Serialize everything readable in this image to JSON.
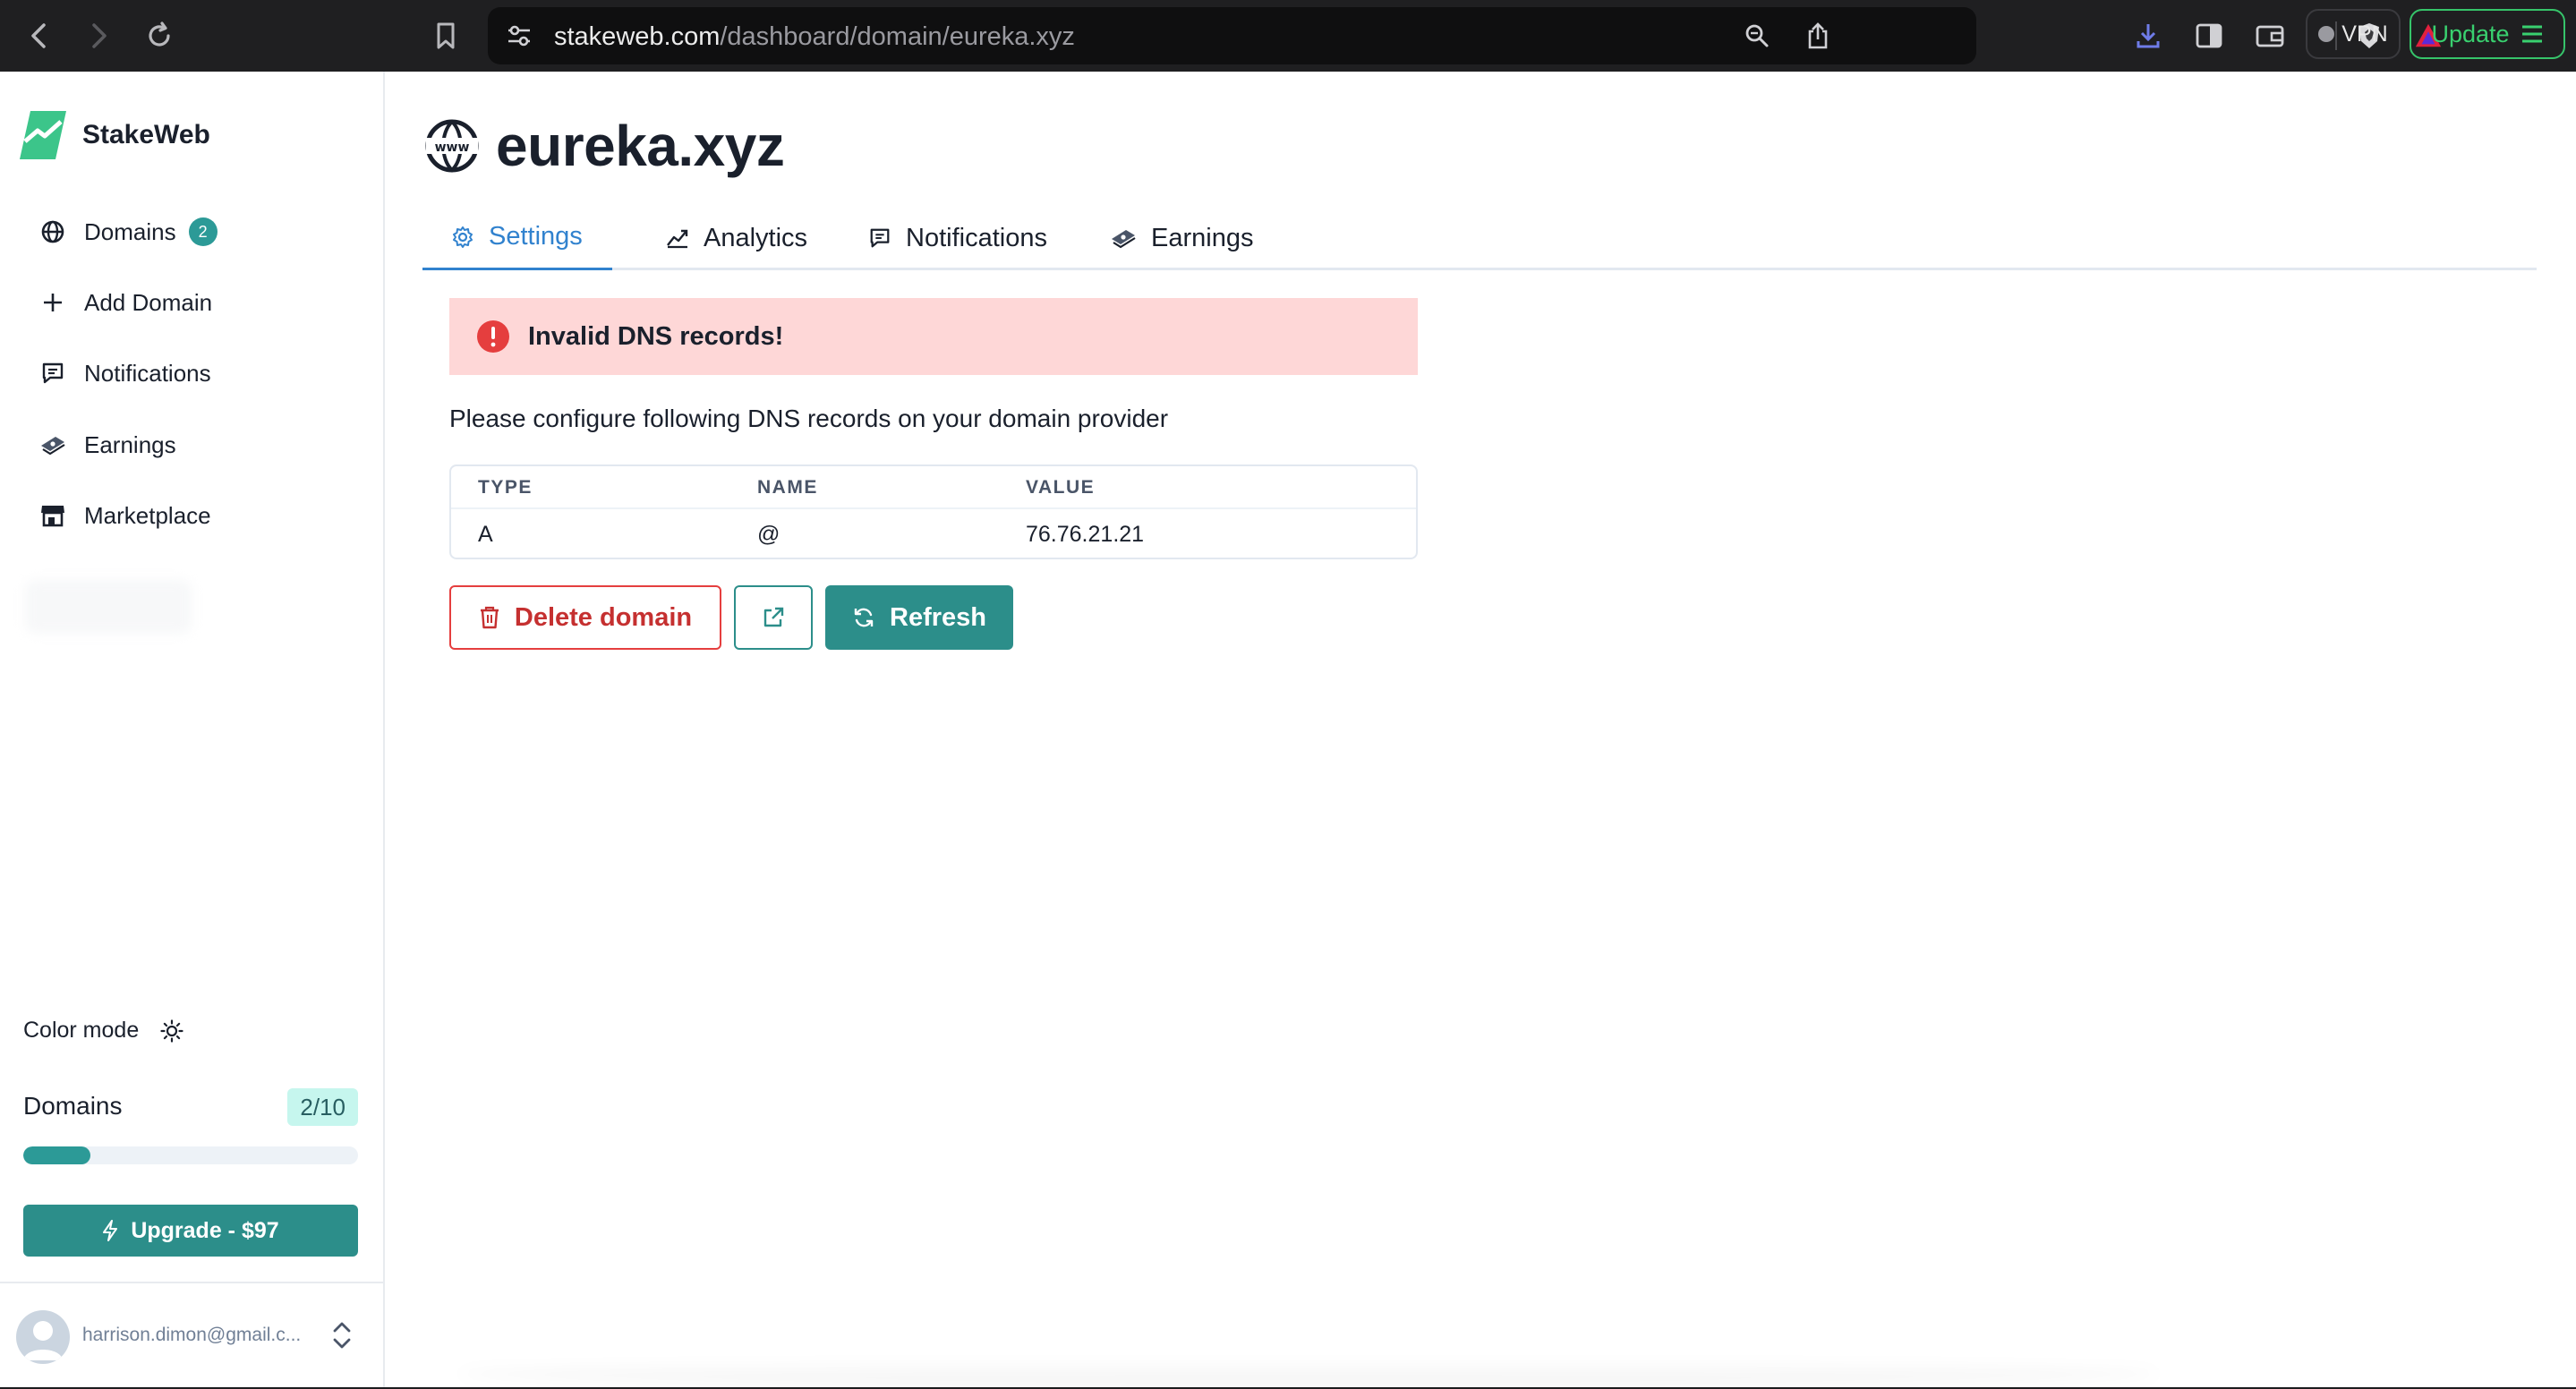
{
  "browser": {
    "url_host": "stakeweb.com",
    "url_path": "/dashboard/domain/eureka.xyz",
    "vpn_label": "VPN",
    "update_label": "Update"
  },
  "sidebar": {
    "brand": "StakeWeb",
    "items": [
      {
        "label": "Domains",
        "icon": "globe-icon",
        "badge": "2"
      },
      {
        "label": "Add Domain",
        "icon": "plus-icon"
      },
      {
        "label": "Notifications",
        "icon": "message-icon"
      },
      {
        "label": "Earnings",
        "icon": "money-icon"
      },
      {
        "label": "Marketplace",
        "icon": "store-icon"
      }
    ],
    "color_mode_label": "Color mode",
    "usage": {
      "label": "Domains",
      "count_text": "2/10",
      "used": 2,
      "limit": 10
    },
    "upgrade_label": "Upgrade - $97",
    "user_email": "harrison.dimon@gmail.c..."
  },
  "main": {
    "domain": "eureka.xyz",
    "tabs": [
      {
        "label": "Settings",
        "icon": "gear-icon",
        "active": true
      },
      {
        "label": "Analytics",
        "icon": "chart-icon"
      },
      {
        "label": "Notifications",
        "icon": "message-icon"
      },
      {
        "label": "Earnings",
        "icon": "money-icon"
      }
    ],
    "alert": "Invalid DNS records!",
    "instructions": "Please configure following DNS records on your domain provider",
    "table": {
      "headers": [
        "TYPE",
        "NAME",
        "VALUE"
      ],
      "rows": [
        [
          "A",
          "@",
          "76.76.21.21"
        ]
      ]
    },
    "buttons": {
      "delete": "Delete domain",
      "refresh": "Refresh"
    }
  },
  "colors": {
    "accent": "#2c8e8a",
    "active_tab": "#3182ce",
    "alert_bg": "#fed7d7",
    "danger": "#e53e3e"
  }
}
